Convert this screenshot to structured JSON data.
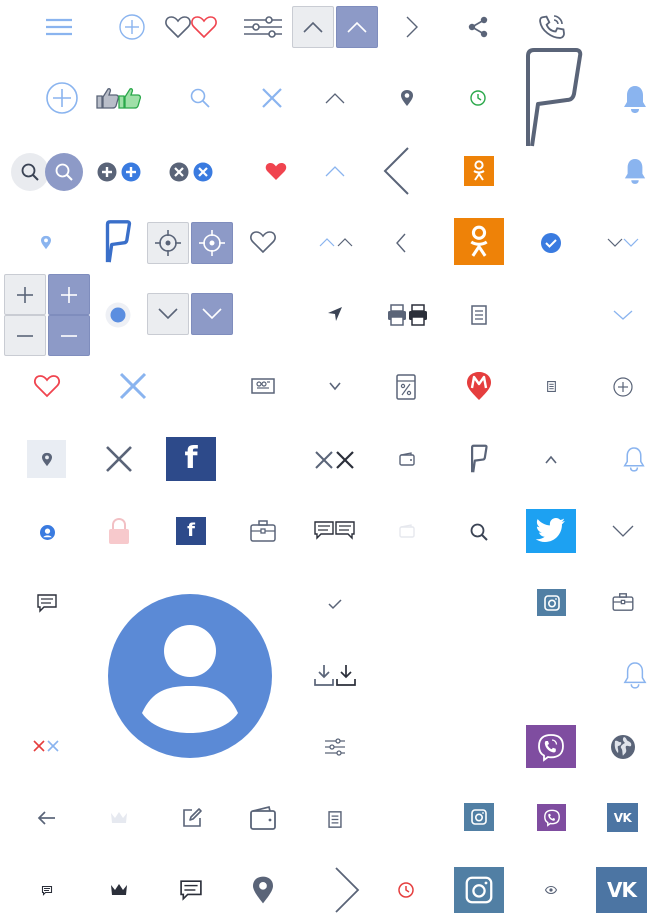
{
  "icons": {
    "row1": [
      "menu-icon",
      "plus-circle-icon",
      "heart-outline-icon",
      "heart-red-outline-icon",
      "sliders-icon",
      "chevron-up-icon",
      "chevron-up-icon",
      "chevron-right-icon",
      "share-icon",
      "phone-call-icon"
    ],
    "row2": [
      "plus-circle-icon",
      "thumbs-up-icon",
      "search-icon",
      "close-icon",
      "chevron-up-icon",
      "location-pin-icon",
      "clock-icon",
      "flag-icon",
      "bell-icon"
    ],
    "row3": [
      "search-icon",
      "add-icon",
      "close-icon",
      "heart-icon",
      "chevron-up-icon",
      "chevron-left-icon",
      "odnoklassniki-icon",
      "bell-icon"
    ],
    "row4": [
      "location-pin-icon",
      "flag-icon",
      "target-icon",
      "heart-outline-icon",
      "chevron-up-icon",
      "chevron-left-icon",
      "odnoklassniki-icon",
      "check-circle-icon",
      "chevron-down-icon"
    ],
    "row5": [
      "zoom-in-icon",
      "zoom-out-icon",
      "radio-icon",
      "chevron-down-icon",
      "navigation-arrow-icon",
      "printer-icon",
      "document-icon",
      "chevron-down-icon"
    ],
    "row6": [
      "heart-outline-icon",
      "close-icon",
      "ticket-icon",
      "chevron-down-icon",
      "discount-icon",
      "metro-icon",
      "document-icon",
      "plus-circle-icon"
    ],
    "row7": [
      "location-pin-icon",
      "close-icon",
      "facebook-icon",
      "close-icon",
      "wallet-icon",
      "flag-icon",
      "chevron-up-icon",
      "bell-icon"
    ],
    "row8": [
      "user-circle-icon",
      "lock-icon",
      "facebook-icon",
      "briefcase-icon",
      "chat-icon",
      "wallet-icon",
      "search-icon",
      "twitter-icon",
      "chevron-down-icon"
    ],
    "row9": [
      "chat-icon",
      "avatar-icon",
      "check-icon",
      "instagram-icon",
      "briefcase-icon"
    ],
    "row10": [
      "download-icon",
      "bell-icon"
    ],
    "row11": [
      "close-icon",
      "sliders-icon",
      "viber-icon",
      "globe-icon"
    ],
    "row12": [
      "arrow-left-icon",
      "crown-icon",
      "edit-icon",
      "wallet-icon",
      "document-icon",
      "instagram-icon",
      "viber-icon",
      "vk-icon"
    ],
    "row13": [
      "chat-icon",
      "crown-icon",
      "chat-icon",
      "location-pin-icon",
      "chevron-right-icon",
      "clock-icon",
      "instagram-icon",
      "eye-icon",
      "vk-icon"
    ]
  },
  "logos": {
    "facebook": "f",
    "vk": "VK"
  },
  "colors": {
    "icon_gray": "#5a6478",
    "icon_blue": "#5b8ee0",
    "light_blue": "#8ab4ef",
    "heart_red": "#f0444f",
    "odnoklassniki_orange": "#ee8208",
    "facebook_blue": "#3b5998",
    "twitter_blue": "#1da1f2",
    "instagram_blue": "#517fa4",
    "viber_purple": "#7f4da0",
    "vk_blue": "#4c75a3",
    "avatar_blue": "#5b8ad6",
    "button_blue": "#8d9ac7",
    "metro_red": "#e53e3e",
    "clock_green": "#2aa84a"
  }
}
